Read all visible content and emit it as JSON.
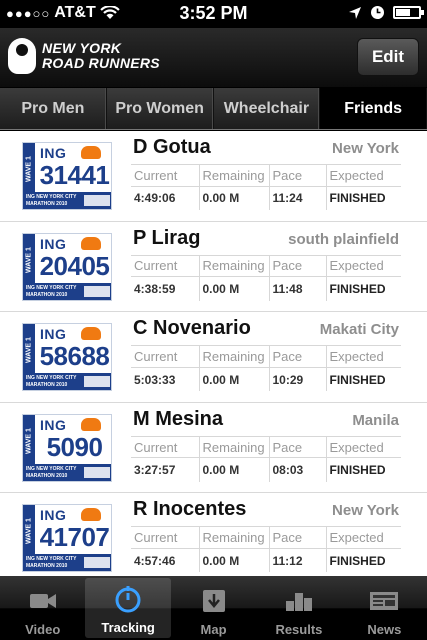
{
  "status": {
    "carrier": "AT&T",
    "time": "3:52 PM"
  },
  "header": {
    "logo_line1": "NEW YORK",
    "logo_line2": "ROAD RUNNERS",
    "edit_label": "Edit"
  },
  "segments": [
    {
      "label": "Pro Men",
      "active": false
    },
    {
      "label": "Pro Women",
      "active": false
    },
    {
      "label": "Wheelchair",
      "active": false
    },
    {
      "label": "Friends",
      "active": true
    }
  ],
  "bib_text": {
    "brand": "ING",
    "wave": "WAVE 1",
    "event_line1": "ING NEW YORK CITY",
    "event_line2": "MARATHON 2010"
  },
  "columns": [
    "Current",
    "Remaining",
    "Pace",
    "Expected"
  ],
  "runners": [
    {
      "name": "D Gotua",
      "city": "New York",
      "bib": "31441",
      "current": "4:49:06",
      "remaining": "0.00 M",
      "pace": "11:24",
      "expected": "FINISHED"
    },
    {
      "name": "P Lirag",
      "city": "south plainfield",
      "bib": "20405",
      "current": "4:38:59",
      "remaining": "0.00 M",
      "pace": "11:48",
      "expected": "FINISHED"
    },
    {
      "name": "C Novenario",
      "city": "Makati City",
      "bib": "58688",
      "current": "5:03:33",
      "remaining": "0.00 M",
      "pace": "10:29",
      "expected": "FINISHED"
    },
    {
      "name": "M Mesina",
      "city": "Manila",
      "bib": "5090",
      "current": "3:27:57",
      "remaining": "0.00 M",
      "pace": "08:03",
      "expected": "FINISHED"
    },
    {
      "name": "R Inocentes",
      "city": "New York",
      "bib": "41707",
      "current": "4:57:46",
      "remaining": "0.00 M",
      "pace": "11:12",
      "expected": "FINISHED"
    }
  ],
  "tabs": [
    {
      "label": "Video",
      "icon": "video-camera-icon",
      "active": false
    },
    {
      "label": "Tracking",
      "icon": "stopwatch-icon",
      "active": true
    },
    {
      "label": "Map",
      "icon": "map-icon",
      "active": false
    },
    {
      "label": "Results",
      "icon": "results-bars-icon",
      "active": false
    },
    {
      "label": "News",
      "icon": "newspaper-icon",
      "active": false
    }
  ],
  "colors": {
    "bib_blue": "#1d3f8a",
    "bib_orange": "#f07a12",
    "city_gray": "#8e8e8e"
  }
}
